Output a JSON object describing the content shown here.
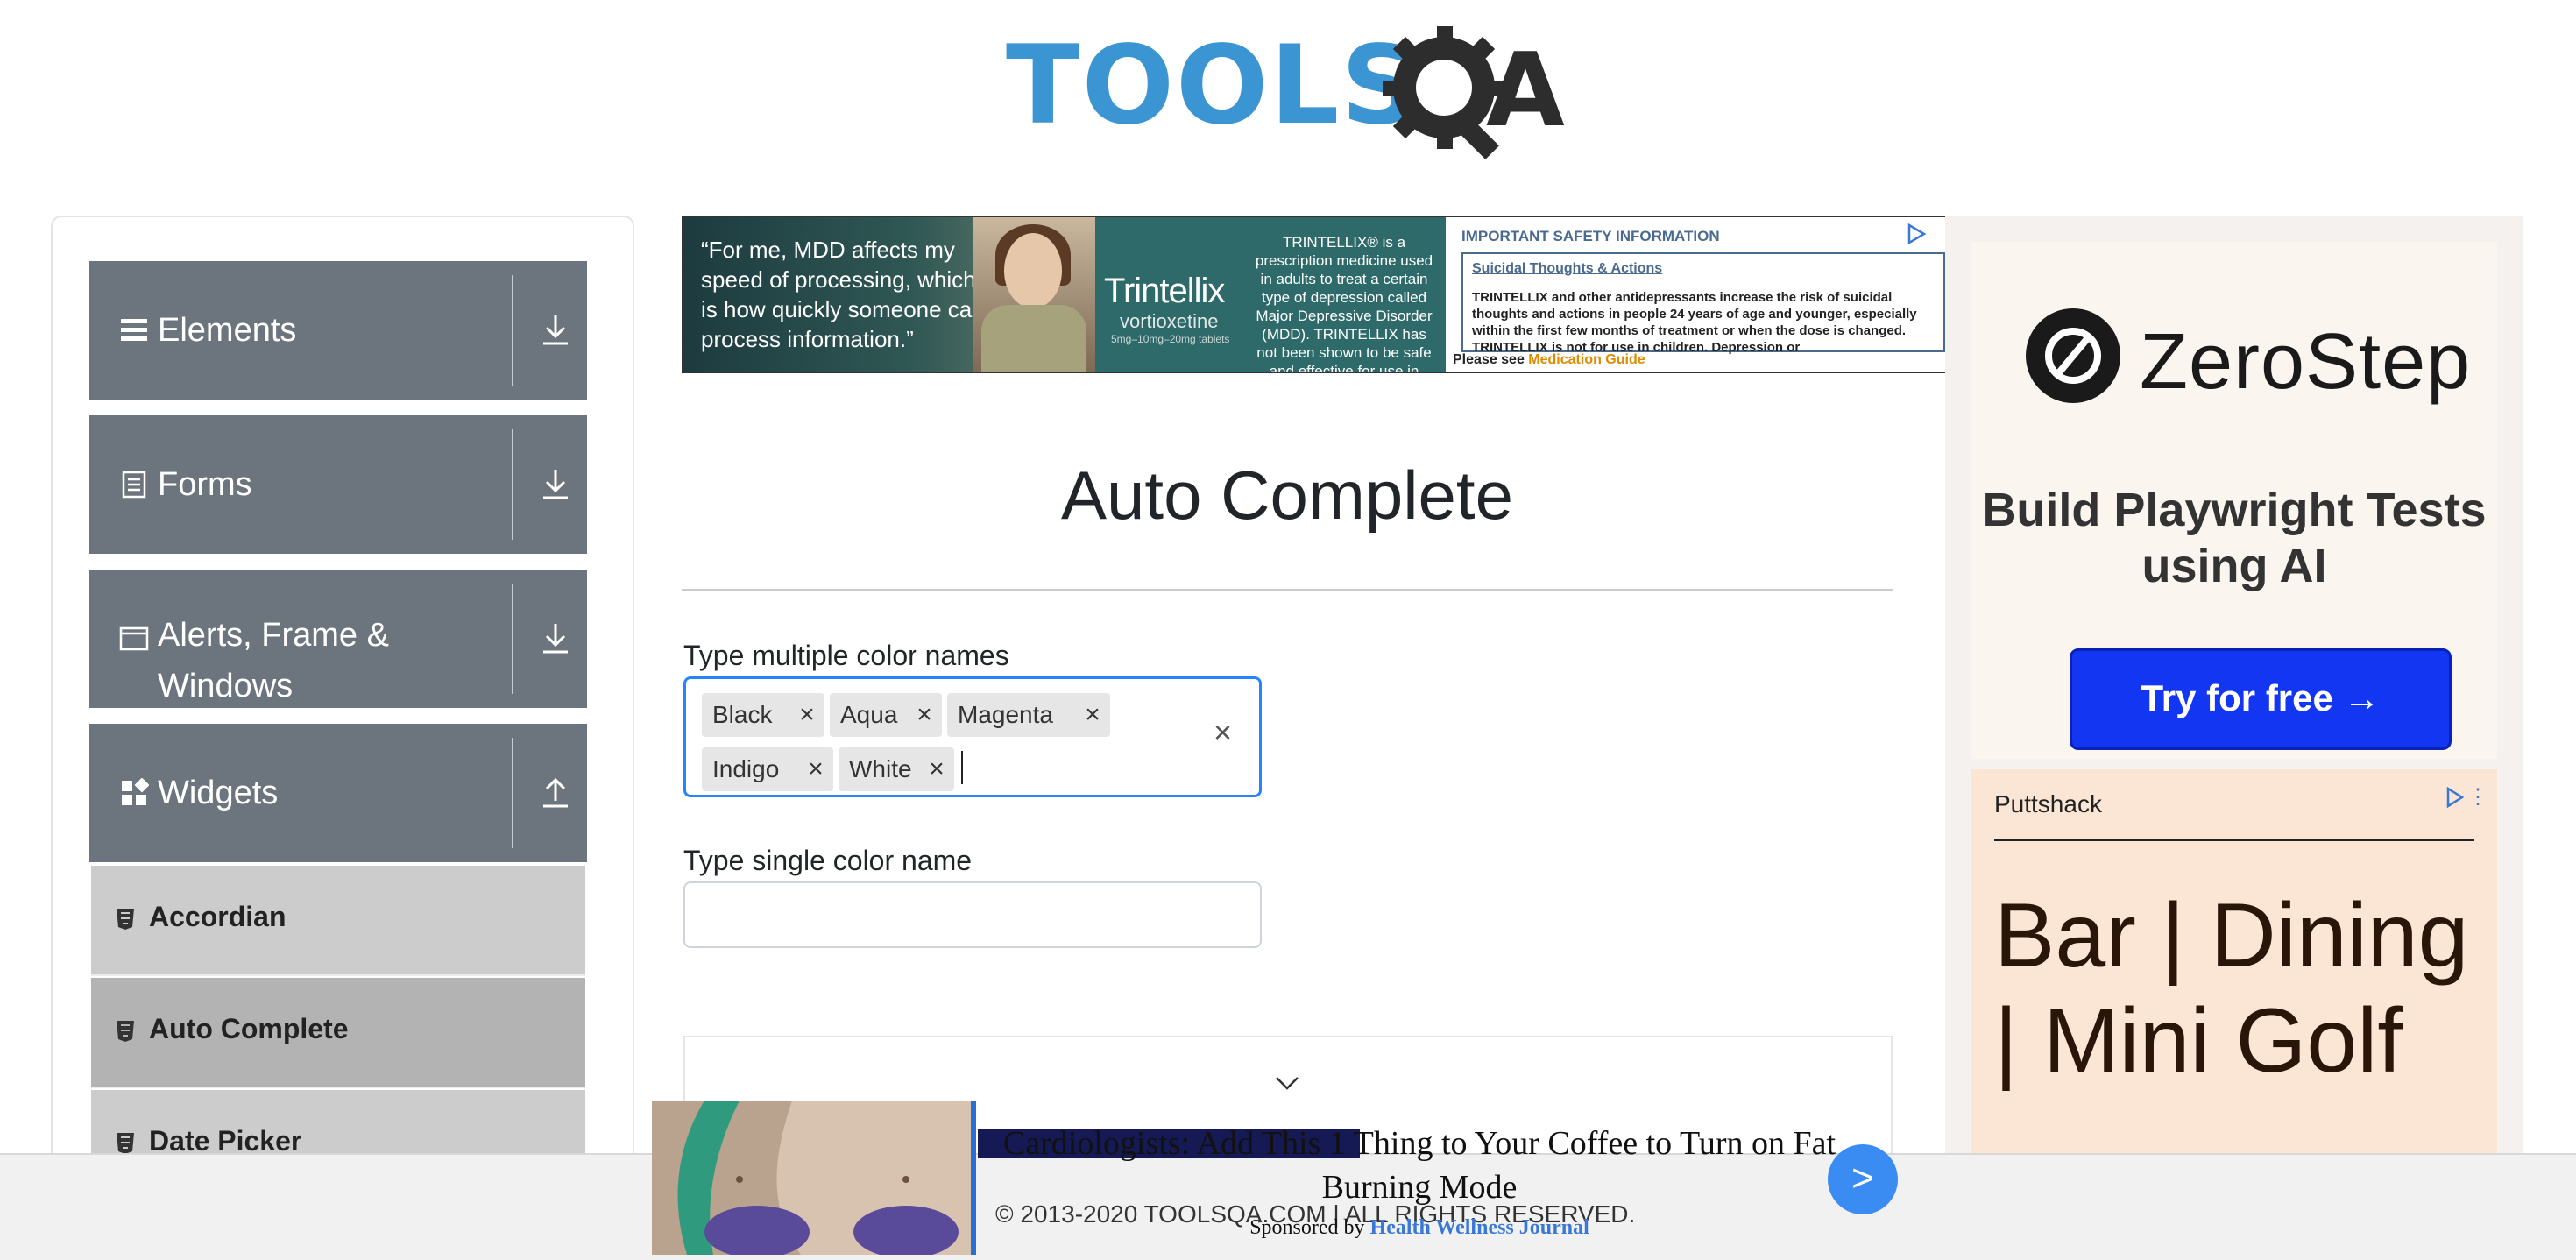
{
  "header": {
    "logo_text": "TOOLS",
    "logo_a": "A"
  },
  "nav": {
    "groups": [
      {
        "label": "Elements"
      },
      {
        "label": "Forms"
      },
      {
        "label": "Alerts, Frame & Windows"
      },
      {
        "label": "Widgets"
      }
    ],
    "widget_items": [
      {
        "label": "Accordian"
      },
      {
        "label": "Auto Complete"
      },
      {
        "label": "Date Picker"
      }
    ]
  },
  "top_ad": {
    "quote": "“For me, MDD affects my speed of processing, which is how quickly someone can process information.”",
    "brand": "Trintellix",
    "generic": "vortioxetine",
    "dose": "5mg–10mg–20mg tablets",
    "description": "TRINTELLIX® is a prescription medicine used in adults to treat a certain type of depression called Major Depressive Disorder (MDD). TRINTELLIX has not been shown to be safe and effective for use in children.",
    "safety_heading": "IMPORTANT SAFETY INFORMATION",
    "safety_title": "Suicidal Thoughts & Actions",
    "safety_body": "TRINTELLIX and other antidepressants increase the risk of suicidal thoughts and actions in people 24 years of age and younger, especially within the first few months of treatment or when the dose is changed. TRINTELLIX is not for use in children. Depression or",
    "safety_footer_prefix": "Please see ",
    "safety_footer_link": "Medication Guide"
  },
  "main": {
    "title": "Auto Complete",
    "multi_label": "Type multiple color names",
    "chips": [
      "Black",
      "Aqua",
      "Magenta",
      "Indigo",
      "White"
    ],
    "chip_remove": "×",
    "clear_all": "×",
    "single_label": "Type single color name",
    "single_value": ""
  },
  "right_ad": {
    "brand": "ZeroStep",
    "tagline": "Build Playwright Tests using AI",
    "cta": "Try for free →",
    "advertiser": "Puttshack",
    "headline": "Bar | Dining | Mini Golf"
  },
  "bottom_ad": {
    "headline": "Cardiologists: Add This 1 Thing to Your Coffee to Turn on Fat Burning Mode",
    "sponsor_prefix": "Sponsored by ",
    "sponsor": "Health Wellness Journal",
    "go": ">"
  },
  "footer": {
    "copyright": "© 2013-2020 TOOLSQA.COM | ALL RIGHTS RESERVED."
  },
  "colors": {
    "accent": "#2684ff",
    "nav_group": "#6c757d",
    "logo_blue": "#3a95d2"
  }
}
